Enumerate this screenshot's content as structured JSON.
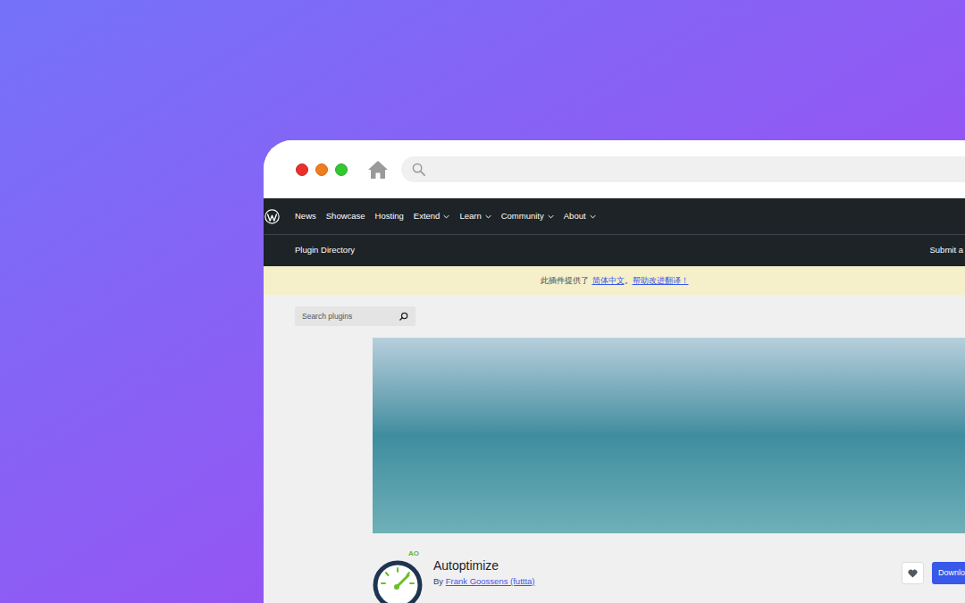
{
  "nav": {
    "items": [
      {
        "label": "News",
        "has_menu": false
      },
      {
        "label": "Showcase",
        "has_menu": false
      },
      {
        "label": "Hosting",
        "has_menu": false
      },
      {
        "label": "Extend",
        "has_menu": true
      },
      {
        "label": "Learn",
        "has_menu": true
      },
      {
        "label": "Community",
        "has_menu": true
      },
      {
        "label": "About",
        "has_menu": true
      }
    ]
  },
  "subnav": {
    "title": "Plugin Directory",
    "action": "Submit a"
  },
  "notice": {
    "prefix": "此插件提供了",
    "language": "简体中文",
    "separator": "。",
    "help": "帮助改进翻译！"
  },
  "search": {
    "placeholder": "Search plugins"
  },
  "plugin": {
    "icon_label": "AO",
    "name": "Autoptimize",
    "by": "By",
    "author": "Frank Goossens (futtta)",
    "download": "Downlo"
  }
}
